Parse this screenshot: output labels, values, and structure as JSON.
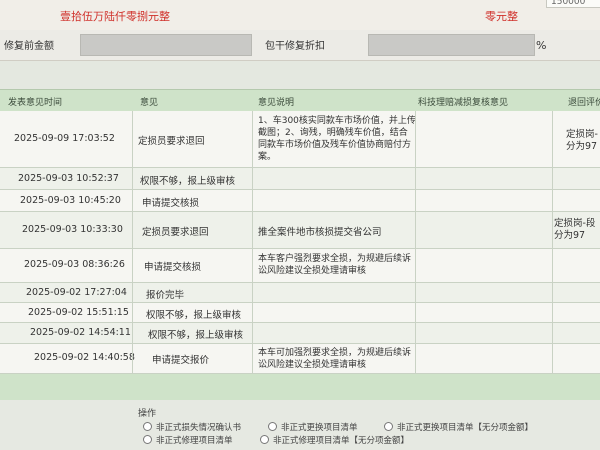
{
  "top": {
    "amount_words": "壹拾伍万陆仟零捌元整",
    "amount_words_right": "零元整",
    "corner_value": "150000"
  },
  "repair": {
    "before_amount_label": "修复前金额",
    "package_discount_label": "包干修复折扣",
    "percent_sign": "%"
  },
  "table": {
    "headers": [
      "发表意见时间",
      "意见",
      "意见说明",
      "科技理赔减损复核意见",
      "退回评价"
    ],
    "rows": [
      {
        "time": "2025-09-09 17:03:52",
        "opinion": "定损员要求退回",
        "desc": "1、车300核实同款车市场价值，并上传截图；2、询残，明确残车价值，结合同款车市场价值及残车价值协商赔付方案。",
        "review": "",
        "eval": "定损岗-\n分为97"
      },
      {
        "time": "2025-09-03 10:52:37",
        "opinion": "权限不够，报上级审核",
        "desc": "",
        "review": "",
        "eval": ""
      },
      {
        "time": "2025-09-03 10:45:20",
        "opinion": "申请提交核损",
        "desc": "",
        "review": "",
        "eval": ""
      },
      {
        "time": "2025-09-03 10:33:30",
        "opinion": "定损员要求退回",
        "desc": "推全案件地市核损提交省公司",
        "review": "",
        "eval": "定损岗-段\n分为97"
      },
      {
        "time": "2025-09-03 08:36:26",
        "opinion": "申请提交核损",
        "desc": "本车客户强烈要求全损，为规避后续诉讼风险建议全损处理请审核",
        "review": "",
        "eval": ""
      },
      {
        "time": "2025-09-02 17:27:04",
        "opinion": "报价完毕",
        "desc": "",
        "review": "",
        "eval": ""
      },
      {
        "time": "2025-09-02 15:51:15",
        "opinion": "权限不够，报上级审核",
        "desc": "",
        "review": "",
        "eval": ""
      },
      {
        "time": "2025-09-02 14:54:11",
        "opinion": "权限不够，报上级审核",
        "desc": "",
        "review": "",
        "eval": ""
      },
      {
        "time": "2025-09-02 14:40:58",
        "opinion": "申请提交报价",
        "desc": "本车可加强烈要求全损，为规避后续诉讼风险建议全损处理请审核",
        "review": "",
        "eval": ""
      }
    ]
  },
  "operations": {
    "label": "操作",
    "options": [
      "非正式损失情况确认书",
      "非正式更换项目清单",
      "非正式更换项目清单【无分项金额】",
      "非正式修理项目清单",
      "非正式修理项目清单【无分项金额】"
    ]
  }
}
